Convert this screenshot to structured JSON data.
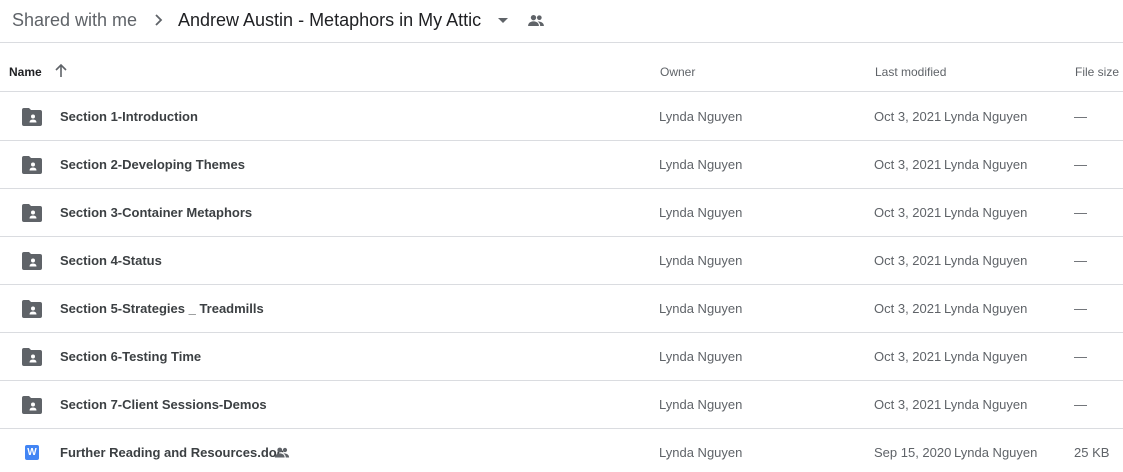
{
  "breadcrumb": {
    "root_label": "Shared with me",
    "separator_icon": "chevron-right-icon",
    "current_label": "Andrew Austin - Metaphors in My Attic",
    "dropdown_icon": "caret-down-icon",
    "shared_icon": "people-icon"
  },
  "columns": {
    "name": "Name",
    "sort_icon": "arrow-up-icon",
    "owner": "Owner",
    "last_modified": "Last modified",
    "file_size": "File size"
  },
  "files": [
    {
      "type": "folder-shared",
      "icon": "shared-folder-icon",
      "name": "Section 1-Introduction",
      "owner": "Lynda Nguyen",
      "modified_date": "Oct 3, 2021",
      "modified_by": "Lynda Nguyen",
      "size": "—",
      "shared": false
    },
    {
      "type": "folder-shared",
      "icon": "shared-folder-icon",
      "name": "Section 2-Developing Themes",
      "owner": "Lynda Nguyen",
      "modified_date": "Oct 3, 2021",
      "modified_by": "Lynda Nguyen",
      "size": "—",
      "shared": false
    },
    {
      "type": "folder-shared",
      "icon": "shared-folder-icon",
      "name": "Section 3-Container Metaphors",
      "owner": "Lynda Nguyen",
      "modified_date": "Oct 3, 2021",
      "modified_by": "Lynda Nguyen",
      "size": "—",
      "shared": false
    },
    {
      "type": "folder-shared",
      "icon": "shared-folder-icon",
      "name": "Section 4-Status",
      "owner": "Lynda Nguyen",
      "modified_date": "Oct 3, 2021",
      "modified_by": "Lynda Nguyen",
      "size": "—",
      "shared": false
    },
    {
      "type": "folder-shared",
      "icon": "shared-folder-icon",
      "name": "Section 5-Strategies _ Treadmills",
      "owner": "Lynda Nguyen",
      "modified_date": "Oct 3, 2021",
      "modified_by": "Lynda Nguyen",
      "size": "—",
      "shared": false
    },
    {
      "type": "folder-shared",
      "icon": "shared-folder-icon",
      "name": "Section 6-Testing Time",
      "owner": "Lynda Nguyen",
      "modified_date": "Oct 3, 2021",
      "modified_by": "Lynda Nguyen",
      "size": "—",
      "shared": false
    },
    {
      "type": "folder-shared",
      "icon": "shared-folder-icon",
      "name": "Section 7-Client Sessions-Demos",
      "owner": "Lynda Nguyen",
      "modified_date": "Oct 3, 2021",
      "modified_by": "Lynda Nguyen",
      "size": "—",
      "shared": false
    },
    {
      "type": "word-doc",
      "icon": "word-doc-icon",
      "icon_letter": "W",
      "name": "Further Reading and Resources.doc",
      "owner": "Lynda Nguyen",
      "modified_date": "Sep 15, 2020",
      "modified_by": "Lynda Nguyen",
      "size": "25 KB",
      "shared": true
    }
  ],
  "colors": {
    "text_primary": "#3c4043",
    "text_secondary": "#5f6368",
    "divider": "#dadce0",
    "icon_gray": "#5f6368",
    "word_blue": "#4285f4"
  }
}
